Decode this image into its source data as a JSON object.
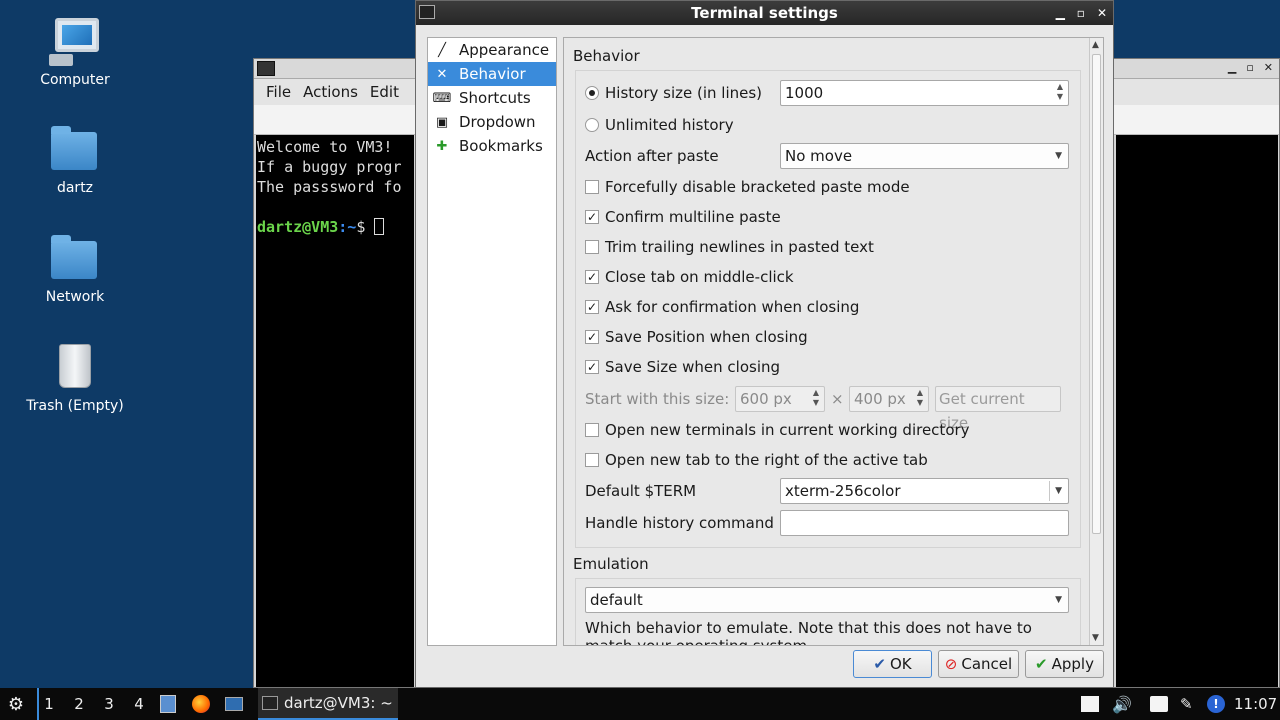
{
  "desktop": {
    "icons": [
      {
        "label": "Computer",
        "icon": "computer-icon"
      },
      {
        "label": "dartz",
        "icon": "home-folder-icon"
      },
      {
        "label": "Network",
        "icon": "network-folder-icon"
      },
      {
        "label": "Trash (Empty)",
        "icon": "trash-icon"
      }
    ]
  },
  "terminal": {
    "menu": [
      "File",
      "Actions",
      "Edit"
    ],
    "lines": [
      "Welcome to VM3!",
      "If a buggy progr",
      "The passsword fo"
    ],
    "prompt_user": "dartz@VM3",
    "prompt_path": ":~",
    "prompt_symbol": "$"
  },
  "dialog": {
    "title": "Terminal settings",
    "nav": [
      {
        "label": "Appearance",
        "icon": "appearance-icon",
        "selected": false
      },
      {
        "label": "Behavior",
        "icon": "behavior-icon",
        "selected": true
      },
      {
        "label": "Shortcuts",
        "icon": "shortcuts-icon",
        "selected": false
      },
      {
        "label": "Dropdown",
        "icon": "dropdown-icon",
        "selected": false
      },
      {
        "label": "Bookmarks",
        "icon": "bookmarks-icon",
        "selected": false
      }
    ],
    "behavior": {
      "section_title": "Behavior",
      "history_size_label": "History size (in lines)",
      "history_size_value": "1000",
      "unlimited_history_label": "Unlimited history",
      "action_after_paste_label": "Action after paste",
      "action_after_paste_value": "No move",
      "checkboxes": [
        {
          "label": "Forcefully disable bracketed paste mode",
          "checked": false
        },
        {
          "label": "Confirm multiline paste",
          "checked": true
        },
        {
          "label": "Trim trailing newlines in pasted text",
          "checked": false
        },
        {
          "label": "Close tab on middle-click",
          "checked": true
        },
        {
          "label": "Ask for confirmation when closing",
          "checked": true
        },
        {
          "label": "Save Position when closing",
          "checked": true
        },
        {
          "label": "Save Size when closing",
          "checked": true
        }
      ],
      "start_size_label": "Start with this size:",
      "start_width": "600 px",
      "times": "×",
      "start_height": "400 px",
      "get_current_size": "Get current size",
      "open_cwd_label": "Open new terminals in current working directory",
      "open_right_label": "Open new tab to the right of the active tab",
      "default_term_label": "Default $TERM",
      "default_term_value": "xterm-256color",
      "handle_history_label": "Handle history command",
      "handle_history_value": ""
    },
    "emulation": {
      "section_title": "Emulation",
      "value": "default",
      "description_line1": "Which behavior to emulate. Note that this does not have to",
      "description_line2": "match your operating system."
    },
    "buttons": {
      "ok": "OK",
      "cancel": "Cancel",
      "apply": "Apply"
    }
  },
  "taskbar": {
    "workspaces": [
      "1",
      "2",
      "3",
      "4"
    ],
    "task_label": "dartz@VM3: ~",
    "clock": "11:07"
  }
}
